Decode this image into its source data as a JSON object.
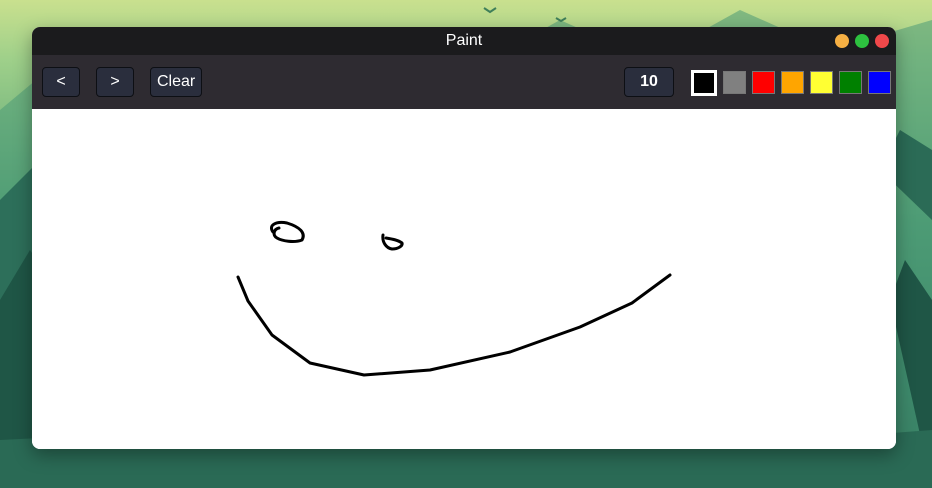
{
  "window": {
    "title": "Paint"
  },
  "window_controls": [
    {
      "name": "minimize-dot",
      "color": "#f6b043"
    },
    {
      "name": "maximize-dot",
      "color": "#2dc13f"
    },
    {
      "name": "close-dot",
      "color": "#f0484a"
    }
  ],
  "toolbar": {
    "undo_label": "<",
    "redo_label": ">",
    "clear_label": "Clear",
    "brush_size": "10"
  },
  "palette": [
    {
      "name": "black",
      "color": "#000000",
      "selected": true
    },
    {
      "name": "gray",
      "color": "#808080",
      "selected": false
    },
    {
      "name": "red",
      "color": "#ff0000",
      "selected": false
    },
    {
      "name": "orange",
      "color": "#ffa500",
      "selected": false
    },
    {
      "name": "yellow",
      "color": "#ffff33",
      "selected": false
    },
    {
      "name": "green",
      "color": "#008000",
      "selected": false
    },
    {
      "name": "blue",
      "color": "#0000ff",
      "selected": false
    }
  ],
  "background": {
    "theme": "forest-landscape"
  }
}
